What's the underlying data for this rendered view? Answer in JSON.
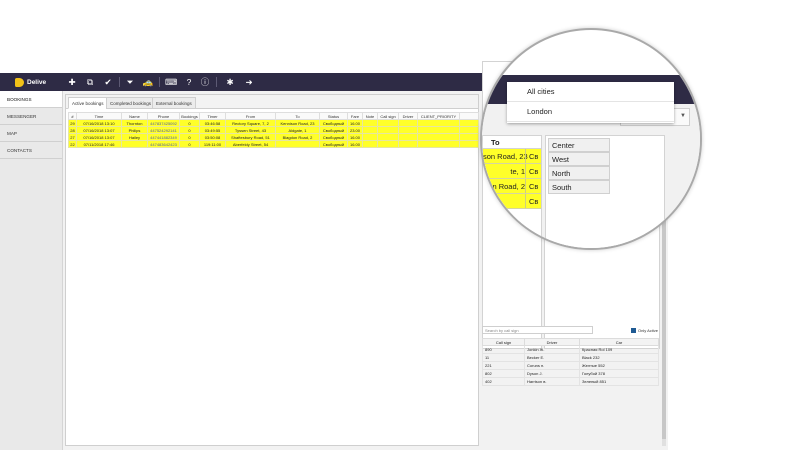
{
  "app": {
    "brand": "Delive"
  },
  "toolbar": {
    "icons": [
      "plus-icon",
      "copy-icon",
      "check-icon",
      "filter-icon",
      "car-icon",
      "keyboard-icon",
      "help-icon",
      "info-icon",
      "bug-icon",
      "logout-icon"
    ]
  },
  "sidebar": {
    "items": [
      {
        "label": "BOOKINGS",
        "active": true
      },
      {
        "label": "MESSENGER",
        "active": false
      },
      {
        "label": "MAP",
        "active": false
      },
      {
        "label": "CONTACTS",
        "active": false
      }
    ]
  },
  "tabs": [
    {
      "label": "Active bookings",
      "active": true
    },
    {
      "label": "Completed bookings",
      "active": false
    },
    {
      "label": "External bookings",
      "active": false
    }
  ],
  "bookings": {
    "columns": [
      "#",
      "Time",
      "Name",
      "Phone",
      "Bookings",
      "Timer",
      "From",
      "To",
      "Status",
      "Fare",
      "Note",
      "Call sign",
      "Driver",
      "CLIENT_PRIORITY"
    ],
    "rows": [
      {
        "id": "29",
        "time": "07/16/2018 13:10",
        "name": "Thornton",
        "phone": "447837425092",
        "bookings": "0",
        "timer": "03:46:58",
        "from": "Rectory Square, 7, 2",
        "to": "Kennison Road, 23",
        "status": "Свободный",
        "fare": "16.00",
        "note": "",
        "callsign": "",
        "driver": "",
        "priority": ""
      },
      {
        "id": "28",
        "time": "07/16/2018 13:07",
        "name": "Philips",
        "phone": "447524292141",
        "bookings": "0",
        "timer": "03:49:55",
        "from": "Tyssen Street, 43",
        "to": "Aldgate, 1",
        "status": "Свободный",
        "fare": "23.00",
        "note": "",
        "callsign": "",
        "driver": "",
        "priority": ""
      },
      {
        "id": "27",
        "time": "07/16/2018 13:07",
        "name": "Hailey",
        "phone": "447441882349",
        "bookings": "0",
        "timer": "03:50:08",
        "from": "Shaftesbury Road, 51",
        "to": "Blagdon Road, 2",
        "status": "Свободный",
        "fare": "16.00",
        "note": "",
        "callsign": "",
        "driver": "",
        "priority": ""
      },
      {
        "id": "22",
        "time": "07/11/2018 17:46",
        "name": "",
        "phone": "447483642423",
        "bookings": "0",
        "timer": "119:11:00",
        "from": "Aberfeldy Street, 54",
        "to": "",
        "status": "Свободный",
        "fare": "16.00",
        "note": "",
        "callsign": "",
        "driver": "",
        "priority": ""
      }
    ]
  },
  "right_panel": {
    "search_placeholder": "Search by call sign",
    "only_active_label": "Only Active",
    "driver_columns": [
      "Call sign",
      "Driver",
      "Car"
    ],
    "drivers": [
      {
        "callsign": "890",
        "driver": "Jonkin Ж.",
        "car": "Красная Rol 109"
      },
      {
        "callsign": "11",
        "driver": "Becker E.",
        "car": "Black 232"
      },
      {
        "callsign": "221",
        "driver": "Coruns п.",
        "car": "Желтые 552"
      },
      {
        "callsign": "802",
        "driver": "Dyson J.",
        "car": "Голубой 378"
      },
      {
        "callsign": "402",
        "driver": "Harrison в.",
        "car": "Зеленый 851"
      }
    ]
  },
  "magnifier": {
    "city_options": [
      "All cities",
      "London"
    ],
    "to_header": "To",
    "to_rows": [
      {
        "to": "son Road, 23",
        "status": "Св"
      },
      {
        "to": "te, 1",
        "status": "Св"
      },
      {
        "to": "n Road, 2",
        "status": "Св"
      },
      {
        "to": "",
        "status": "Св"
      }
    ],
    "zones": [
      "Center",
      "West",
      "North",
      "South"
    ]
  }
}
